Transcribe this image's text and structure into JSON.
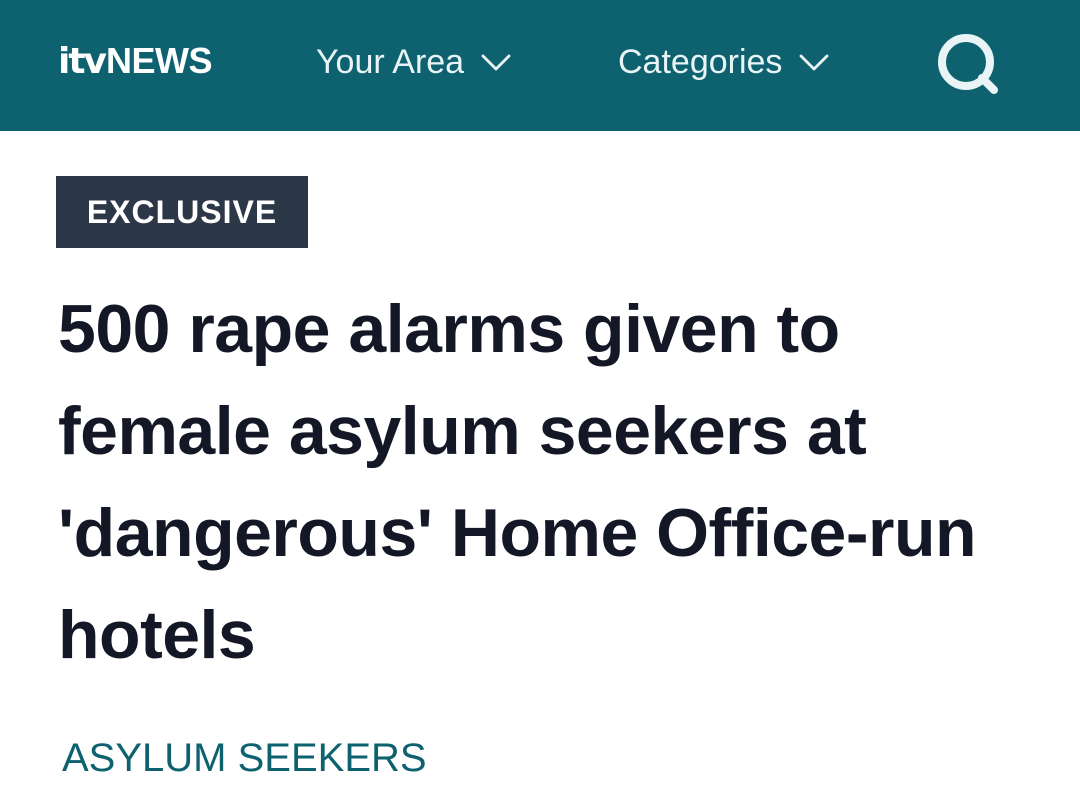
{
  "header": {
    "logo": {
      "itv": "itv",
      "news": "NEWS"
    },
    "nav": [
      {
        "label": "Your Area"
      },
      {
        "label": "Categories"
      }
    ],
    "search_icon": "search-icon",
    "colors": {
      "bar": "#0e6270",
      "text": "#e8f4f5"
    }
  },
  "article": {
    "badge": "EXCLUSIVE",
    "headline": "500 rape alarms given to female asylum seekers at 'dangerous' Home Office-run hotels",
    "tag": "ASYLUM SEEKERS",
    "colors": {
      "badge_bg": "#2c3748",
      "headline": "#141826",
      "tag": "#0e6270"
    }
  }
}
